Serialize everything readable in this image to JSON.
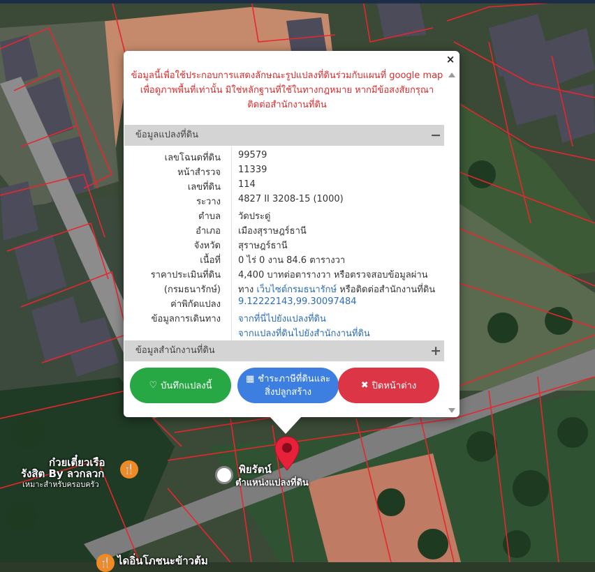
{
  "disclaimer": "ข้อมูลนี้เพื่อใช้ประกอบการแสดงลักษณะรูปแปลงที่ดินร่วมกับแผนที่ google map เพื่อดูภาพพื้นที่เท่านั้น มิใช่หลักฐานที่ใช้ในทางกฎหมาย หากมีข้อสงสัยกรุณาติดต่อสำนักงานที่ดิน",
  "close_symbol": "×",
  "land_section": {
    "title": "ข้อมูลแปลงที่ดิน",
    "toggle": "−",
    "rows": [
      {
        "label": "เลขโฉนดที่ดิน",
        "value": "99579"
      },
      {
        "label": "หน้าสำรวจ",
        "value": "11339"
      },
      {
        "label": "เลขที่ดิน",
        "value": "114"
      },
      {
        "label": "ระวาง",
        "value": "4827 II 3208-15 (1000)"
      },
      {
        "label": "ตำบล",
        "value": "วัดประดู่"
      },
      {
        "label": "อำเภอ",
        "value": "เมืองสุราษฎร์ธานี"
      },
      {
        "label": "จังหวัด",
        "value": "สุราษฎร์ธานี"
      },
      {
        "label": "เนื้อที่",
        "value": "0 ไร่ 0 งาน 84.6 ตารางวา"
      },
      {
        "label": "ราคาประเมินที่ดิน",
        "value": "4,400 บาทต่อตารางวา หรือตรวจสอบข้อมูลผ่าน"
      },
      {
        "label": "(กรมธนารักษ์)",
        "value_prefix": "ทาง ",
        "value_link": "เว็บไซต์กรมธนารักษ์",
        "value_suffix": " หรือติดต่อสำนักงานที่ดิน"
      },
      {
        "label": "ค่าพิกัดแปลง",
        "value_link": "9.12222143,99.30097484"
      },
      {
        "label": "ข้อมูลการเดินทาง",
        "value_link": "จากที่นี่ไปยังแปลงที่ดิน"
      },
      {
        "label": "",
        "value_link": "จากแปลงที่ดินไปยังสำนักงานที่ดิน"
      }
    ]
  },
  "office_section": {
    "title": "ข้อมูลสำนักงานที่ดิน",
    "toggle": "+"
  },
  "buttons": {
    "save": {
      "icon": "♡",
      "label": "บันทึกแปลงนี้"
    },
    "tax": {
      "icon": "▦",
      "line1": "ชำระภาษีที่ดินและ",
      "line2": "สิ่งปลูกสร้าง"
    },
    "close": {
      "icon": "✖",
      "label": "ปิดหน้าต่าง"
    }
  },
  "map_labels": {
    "marker_label": "ตำแหน่งแปลงที่ดิน",
    "poi1_line1": "ก๋วยเตี๋ยวเรือ",
    "poi1_line2": "รังสิต By ลวกลวก",
    "poi1_line3": "เหมาะสำหรับครอบครัว",
    "poi2": "พิยรัตน์",
    "poi3": "ไดอิ่นโภชนะข้าวต้ม"
  },
  "colors": {
    "parcel_line": "#e8262d",
    "marker": "#e8213a",
    "disclaimer": "#dc2b2b",
    "green_button": "#28a745",
    "blue_button": "#3d7fe0",
    "red_button": "#dc3545",
    "link": "#2d6db5"
  }
}
